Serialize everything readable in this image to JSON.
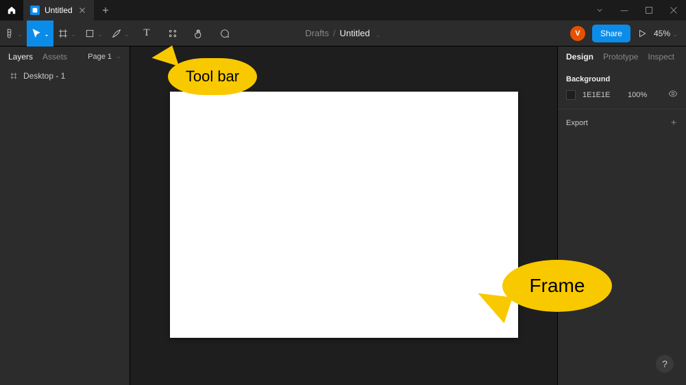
{
  "window": {
    "tab_title": "Untitled"
  },
  "toolbar": {
    "breadcrumb_parent": "Drafts",
    "breadcrumb_doc": "Untitled",
    "avatar_initial": "V",
    "share_label": "Share",
    "zoom_label": "45%"
  },
  "left_panel": {
    "tabs": {
      "layers": "Layers",
      "assets": "Assets"
    },
    "page_selector": "Page 1",
    "layers": [
      {
        "name": "Desktop - 1"
      }
    ]
  },
  "right_panel": {
    "tabs": {
      "design": "Design",
      "prototype": "Prototype",
      "inspect": "Inspect"
    },
    "background_title": "Background",
    "background_hex": "1E1E1E",
    "background_opacity": "100%",
    "export_title": "Export"
  },
  "annotations": {
    "toolbar": "Tool bar",
    "frame": "Frame"
  },
  "help_label": "?"
}
